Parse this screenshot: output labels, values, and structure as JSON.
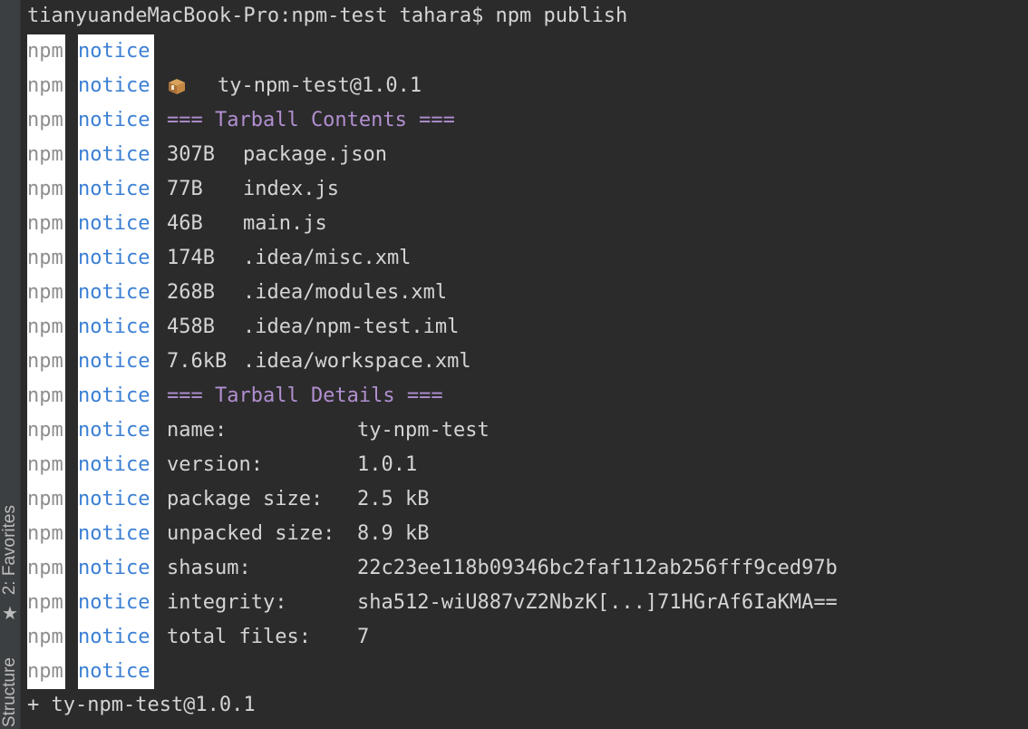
{
  "sidebar": {
    "favorites_label": "2: Favorites",
    "structure_label": "Structure",
    "favorites_icon": "star-icon"
  },
  "terminal": {
    "prompt": "tianyuandeMacBook-Pro:npm-test tahara$ npm publish",
    "npm_tag": "npm",
    "level_tag": "notice",
    "package_icon": "package-icon",
    "package_id": "ty-npm-test@1.0.1",
    "contents_heading": "=== Tarball Contents ===",
    "files": [
      {
        "size": "307B",
        "path": "package.json"
      },
      {
        "size": "77B",
        "path": "index.js"
      },
      {
        "size": "46B",
        "path": "main.js"
      },
      {
        "size": "174B",
        "path": ".idea/misc.xml"
      },
      {
        "size": "268B",
        "path": ".idea/modules.xml"
      },
      {
        "size": "458B",
        "path": ".idea/npm-test.iml"
      },
      {
        "size": "7.6kB",
        "path": ".idea/workspace.xml"
      }
    ],
    "details_heading": "=== Tarball Details ===",
    "details": [
      {
        "key": "name:",
        "value": "ty-npm-test"
      },
      {
        "key": "version:",
        "value": "1.0.1"
      },
      {
        "key": "package size:",
        "value": "2.5 kB"
      },
      {
        "key": "unpacked size:",
        "value": "8.9 kB"
      },
      {
        "key": "shasum:",
        "value": "22c23ee118b09346bc2faf112ab256fff9ced97b"
      },
      {
        "key": "integrity:",
        "value": "sha512-wiU887vZ2NbzK[...]71HGrAf6IaKMA=="
      },
      {
        "key": "total files:",
        "value": "7"
      }
    ],
    "result": "+ ty-npm-test@1.0.1"
  },
  "colors": {
    "background": "#2b2b2b",
    "text": "#d4d4d4",
    "notice": "#3b7fd4",
    "heading": "#b18fd0",
    "npm_tag": "#8e8e8e"
  }
}
